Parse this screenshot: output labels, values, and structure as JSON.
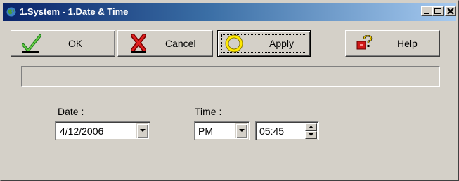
{
  "window": {
    "title": "1.System - 1.Date & Time"
  },
  "toolbar": {
    "ok_label": "OK",
    "cancel_label": "Cancel",
    "apply_label": "Apply",
    "help_label": "Help"
  },
  "status": {
    "text": ""
  },
  "date": {
    "label": "Date :",
    "value": "4/12/2006"
  },
  "time": {
    "label": "Time :",
    "ampm": "PM",
    "value": "05:45"
  },
  "icons": {
    "app": "globe-icon",
    "ok": "checkmark-icon",
    "cancel": "x-icon",
    "apply": "ring-icon",
    "help": "help-icon"
  },
  "colors": {
    "titlebar_start": "#0a246a",
    "titlebar_end": "#a6caf0",
    "face": "#d4d0c8"
  }
}
